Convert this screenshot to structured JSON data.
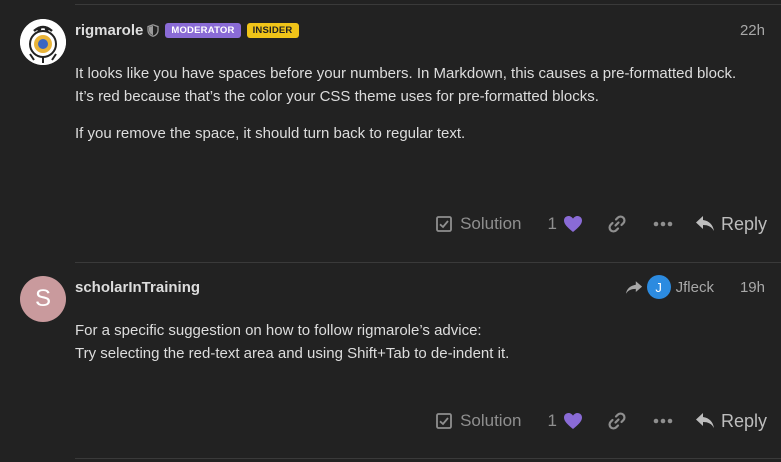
{
  "posts": [
    {
      "username": "rigmarole",
      "badges": [
        "MODERATOR",
        "INSIDER"
      ],
      "time": "22h",
      "paragraphs": [
        "It looks like you have spaces before your numbers. In Markdown, this causes a pre-formatted block. It’s red because that’s the color your CSS theme uses for pre-formatted blocks.",
        "If you remove the space, it should turn back to regular text."
      ],
      "actions": {
        "solution": "Solution",
        "likes": "1",
        "reply": "Reply"
      }
    },
    {
      "username": "scholarInTraining",
      "avatar_letter": "S",
      "reply_to_avatar_letter": "J",
      "reply_to_user": "Jfleck",
      "time": "19h",
      "lines": [
        "For a specific suggestion on how to follow rigmarole’s advice:",
        "Try selecting the red-text area and using Shift+Tab to de-indent it."
      ],
      "actions": {
        "solution": "Solution",
        "likes": "1",
        "reply": "Reply"
      }
    }
  ],
  "colors": {
    "background": "#222222",
    "moderator_badge": "#8a6bd6",
    "insider_badge": "#f0c419",
    "heart": "#8a6bd6",
    "reply_to_avatar": "#2c8be0",
    "avatar_s": "#c99a9d"
  },
  "icons": [
    "shield-icon",
    "checkbox-icon",
    "heart-icon",
    "link-icon",
    "more-icon",
    "reply-arrow-icon"
  ]
}
